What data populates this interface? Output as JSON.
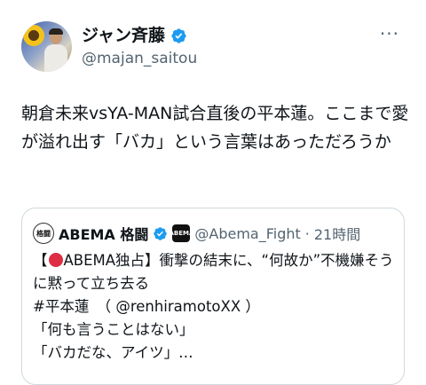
{
  "author": {
    "display_name": "ジャン斉藤",
    "handle": "@majan_saitou",
    "verified_icon": "verified-badge-icon",
    "avatar_icon": "avatar"
  },
  "more_icon": "more-options-icon",
  "tweet": {
    "text": "朝倉未来vsYA-MAN試合直後の平本蓮。ここまで愛が溢れ出す「バカ」という言葉はあっただろうか"
  },
  "quote": {
    "avatar_text": "格闘",
    "display_name": "ABEMA 格闘",
    "badge_text": "ABEMA",
    "handle": "@Abema_Fight",
    "separator": "·",
    "time": "21時間",
    "body_prefix": "【",
    "body_main": "ABEMA独占】衝撃の結末に、“何故か”不機嫌そうに黙って立ち去る\n#平本蓮　（ @renhiramotoXX ）\n「何も言うことはない」\n「バカだな、アイツ」…"
  },
  "colors": {
    "verified": "#1d9bf0",
    "text": "#0f1419",
    "secondary": "#536471",
    "border": "#cfd9de",
    "red": "#dd2e44"
  }
}
